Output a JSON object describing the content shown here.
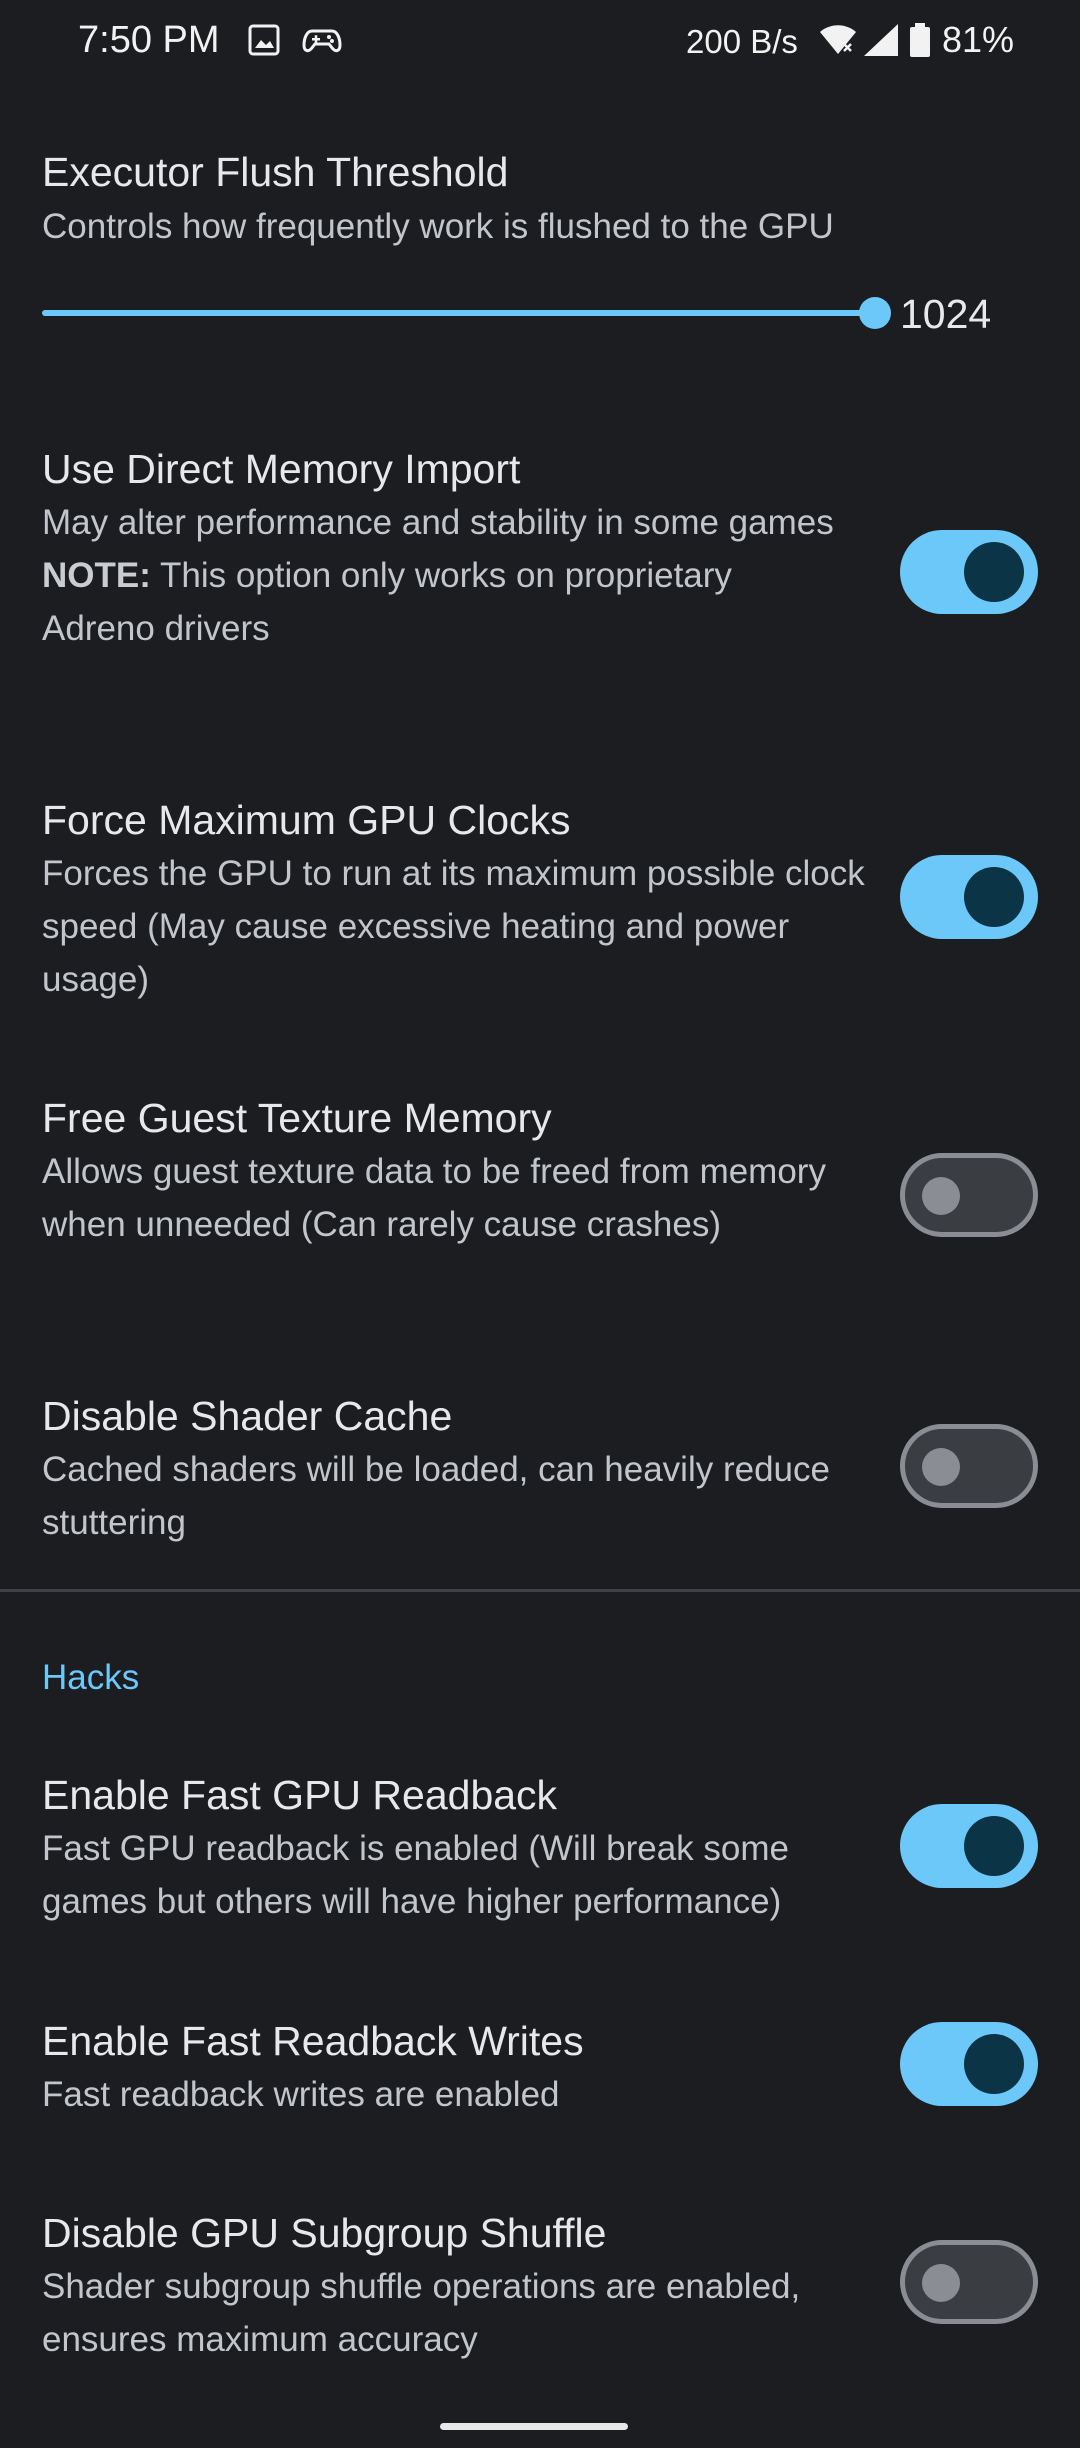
{
  "status_bar": {
    "time": "7:50 PM",
    "icons_left": [
      "gallery-icon",
      "gamepad-icon"
    ],
    "network_speed": "200 B/s",
    "icons_right": [
      "wifi-icon",
      "signal-icon",
      "battery-icon"
    ],
    "battery": "81%"
  },
  "settings": [
    {
      "title": "Executor Flush Threshold",
      "description": "Controls how frequently work is flushed to the GPU",
      "control": "slider",
      "value": "1024",
      "fill": 1.0
    },
    {
      "title": "Use Direct Memory Import",
      "description": "May alter performance and stability in some games",
      "note_label": "NOTE:",
      "note_text": " This option only works on proprietary Adreno drivers",
      "control": "switch",
      "checked": true
    },
    {
      "title": "Force Maximum GPU Clocks",
      "description": "Forces the GPU to run at its maximum possible clock speed (May cause excessive heating and power usage)",
      "control": "switch",
      "checked": true
    },
    {
      "title": "Free Guest Texture Memory",
      "description": "Allows guest texture data to be freed from memory when unneeded (Can rarely cause crashes)",
      "control": "switch",
      "checked": false
    },
    {
      "title": "Disable Shader Cache",
      "description": "Cached shaders will be loaded, can heavily reduce stuttering",
      "control": "switch",
      "checked": false
    }
  ],
  "hacks_section": {
    "header": "Hacks",
    "items": [
      {
        "title": "Enable Fast GPU Readback",
        "description": "Fast GPU readback is enabled (Will break some games but others will have higher performance)",
        "control": "switch",
        "checked": true
      },
      {
        "title": "Enable Fast Readback Writes",
        "description": "Fast readback writes are enabled",
        "control": "switch",
        "checked": true
      },
      {
        "title": "Disable GPU Subgroup Shuffle",
        "description": "Shader subgroup shuffle operations are enabled, ensures maximum accuracy",
        "control": "switch",
        "checked": false
      }
    ]
  },
  "colors": {
    "background": "#1b1d20",
    "accent": "#6cc8f8",
    "switch_knob_on": "#0b3446",
    "switch_off_outline": "#8a8e94"
  }
}
